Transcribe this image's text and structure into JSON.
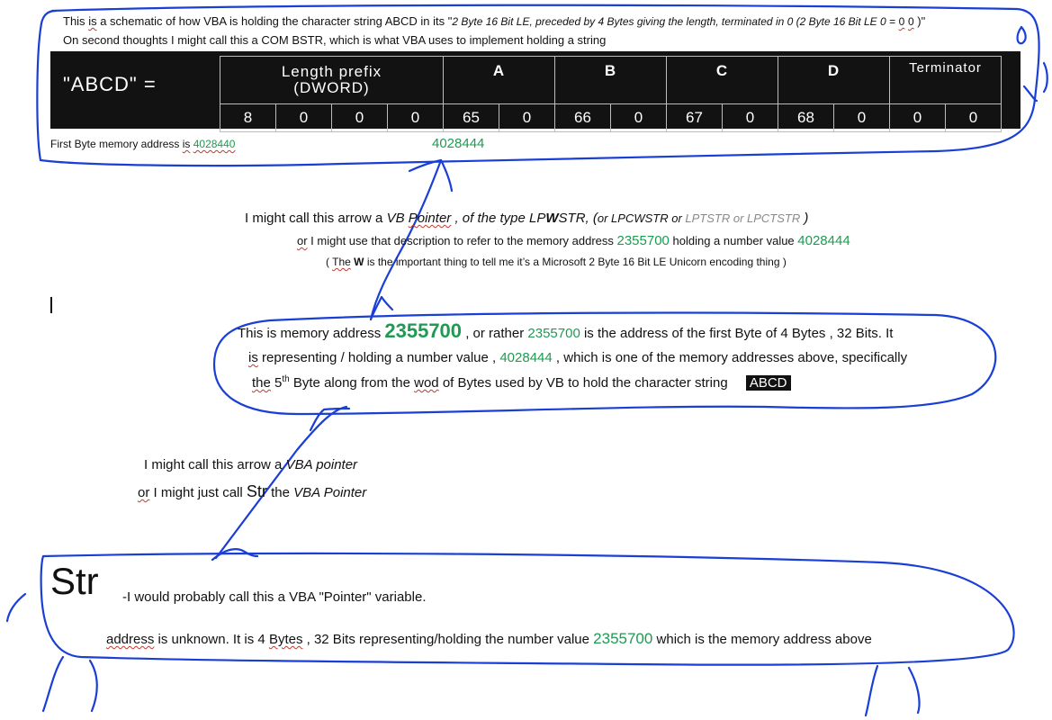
{
  "top": {
    "line1_a": "This",
    "line1_b": "is",
    "line1_c": " a schematic of how VBA is holding the character string  ABCD  in its \"",
    "line1_italic": "2 Byte 16 Bit LE, preceded by 4 Bytes giving the length, terminated in 0 (2 Byte 16 Bit LE 0 =",
    "line1_zero_a": "0",
    "line1_zero_b": "0",
    "line1_end": ")\"",
    "line2": "On second thoughts  I might call this a COM BSTR, which is what VBA uses to implement holding a string"
  },
  "bstr": {
    "label": "\"ABCD\"  =",
    "headers": {
      "length_line1": "Length prefix",
      "length_line2": "(DWORD)",
      "a": "A",
      "b": "B",
      "c": "C",
      "d": "D",
      "terminator": "Terminator"
    },
    "values": [
      "8",
      "0",
      "0",
      "0",
      "65",
      "0",
      "66",
      "0",
      "67",
      "0",
      "68",
      "0",
      "0",
      "0"
    ]
  },
  "first_byte": {
    "prefix": "First Byte memory address ",
    "is": "is",
    "address": "4028440",
    "fifth_address": "4028444"
  },
  "arrow1": {
    "l1_a": "I might call this arrow a ",
    "l1_vb": "VB",
    "l1_pointer": "Pointer",
    "l1_b": " , of the type LP",
    "l1_w": "W",
    "l1_c": "STR, (",
    "l1_lpcw": "or LPCWSTR or ",
    "l1_grey": "LPTSTR or LPCTSTR",
    "l1_end": " )",
    "l2_or": "or",
    "l2_a": " I might use that description to refer to the memory address ",
    "l2_addr": "2355700",
    "l2_b": " holding a number value  ",
    "l2_val": "4028444",
    "l3_a": "( ",
    "l3_the": "The",
    "l3_space": " ",
    "l3_w": "W",
    "l3_b": " is the important thing to tell me it’s a Microsoft 2 Byte 16 Bit LE Unicorn encoding thing )"
  },
  "middle": {
    "l1_a": "This is memory address ",
    "l1_addr_big": "2355700",
    "l1_b": " , or rather ",
    "l1_addr": "2355700",
    "l1_c": "  is the address of the first Byte of 4 Bytes , 32 Bits. It",
    "l2_is": "is",
    "l2_a": " representing / holding a number value ,  ",
    "l2_val": "4028444",
    "l2_b": " , which is one of the  memory addresses above, specifically",
    "l3_the": "the",
    "l3_a": " 5",
    "l3_sup": "th",
    "l3_b": " Byte along from the ",
    "l3_wod": "wod",
    "l3_c": " of Bytes used by VB to hold the character string",
    "l3_hl": "ABCD"
  },
  "arrow2": {
    "l1_a": "I might call this arrow a ",
    "l1_i": "VBA pointer",
    "l2_or": "or",
    "l2_a": " I might just call  ",
    "l2_str": "Str",
    "l2_b": "  the ",
    "l2_i": "VBA Pointer"
  },
  "bottom": {
    "str": "Str",
    "desc": "-I would probably call this a VBA \"Pointer\" variable.",
    "l2_address": "address",
    "l2_a": " is unknown.    It is 4 ",
    "l2_bytes": "Bytes",
    "l2_b": " , 32 Bits representing/holding the number value ",
    "l2_val": "2355700",
    "l2_c": " which is the memory address above"
  },
  "colors": {
    "ink": "#1a3fd6",
    "green": "#1f9a52",
    "grey": "#8a8a8a"
  }
}
